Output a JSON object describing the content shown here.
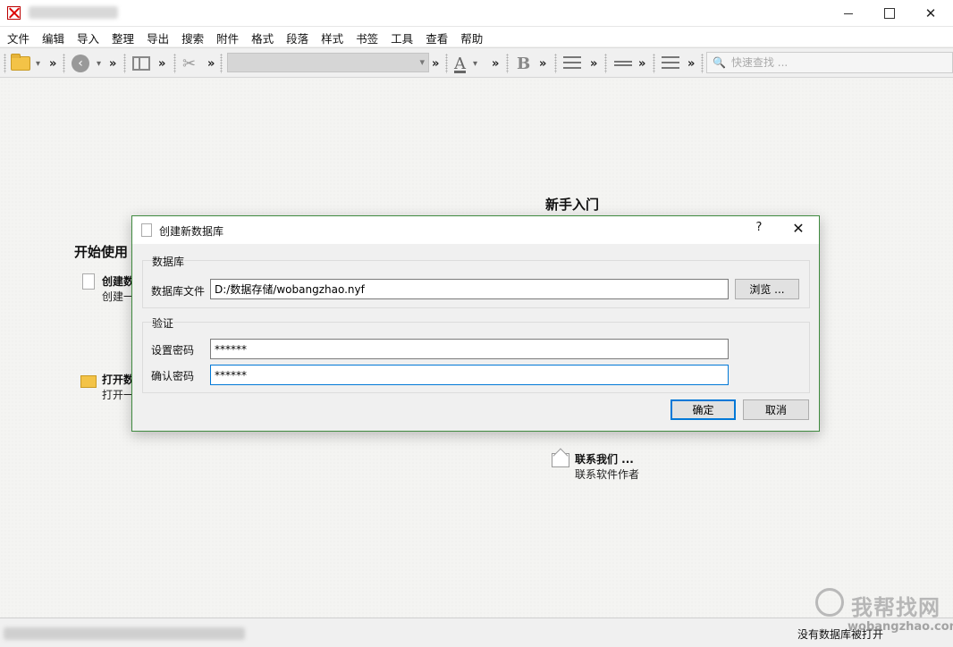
{
  "window": {
    "close_glyph": "✕"
  },
  "menu": [
    "文件",
    "编辑",
    "导入",
    "整理",
    "导出",
    "搜索",
    "附件",
    "格式",
    "段落",
    "样式",
    "书签",
    "工具",
    "查看",
    "帮助"
  ],
  "toolbar": {
    "overflow": "»",
    "dropdown": "▾",
    "search_placeholder": "快速查找 ...",
    "font_letter": "A",
    "bold_letter": "B"
  },
  "start": {
    "new_intro": "新手入门",
    "getting_started": "开始使用",
    "create_title": "创建数",
    "create_sub": "创建一",
    "open_title": "打开数",
    "open_sub": "打开一",
    "contact_title": "联系我们 ...",
    "contact_sub": "联系软件作者"
  },
  "dialog": {
    "title": "创建新数据库",
    "help": "?",
    "close": "✕",
    "db_group": "数据库",
    "db_file_label": "数据库文件",
    "db_file_value": "D:/数据存储/wobangzhao.nyf",
    "browse": "浏览 ...",
    "auth_group": "验证",
    "set_pwd_label": "设置密码",
    "set_pwd_value": "******",
    "confirm_pwd_label": "确认密码",
    "confirm_pwd_value": "******",
    "ok": "确定",
    "cancel": "取消"
  },
  "status": {
    "right_text": "没有数据库被打开"
  },
  "watermark": {
    "text": "我帮找网",
    "url": "wobangzhao.com"
  }
}
